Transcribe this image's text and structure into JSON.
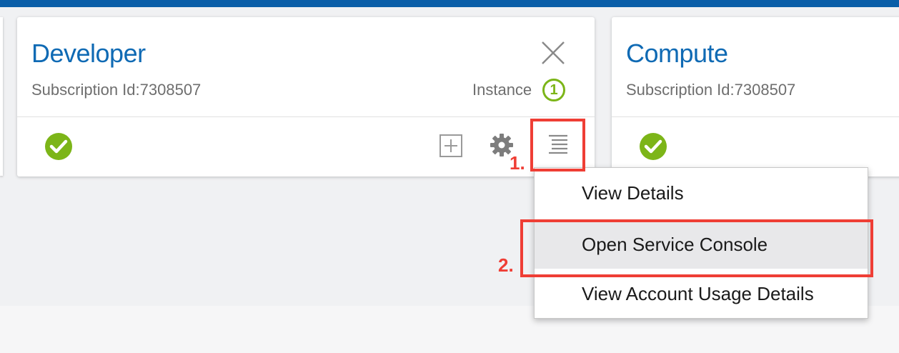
{
  "colors": {
    "brand_blue": "#0a5ea8",
    "title_blue": "#0f6ab4",
    "status_green": "#7cb518",
    "annotation_red": "#ef3e35"
  },
  "cards": [
    {
      "title": "Developer",
      "subscription": "Subscription Id:7308507",
      "instance_label": "Instance",
      "instance_count": "1",
      "status": "check-circle-icon",
      "actions": [
        "add-icon",
        "gear-icon",
        "menu-icon",
        "close-icon"
      ]
    },
    {
      "title": "Compute",
      "subscription": "Subscription Id:7308507",
      "status": "check-circle-icon"
    }
  ],
  "dropdown": {
    "items": [
      {
        "label": "View Details"
      },
      {
        "label": "Open Service Console",
        "hovered": true
      },
      {
        "label": "View Account Usage Details"
      }
    ]
  },
  "annotations": {
    "step1": "1.",
    "step2": "2."
  }
}
